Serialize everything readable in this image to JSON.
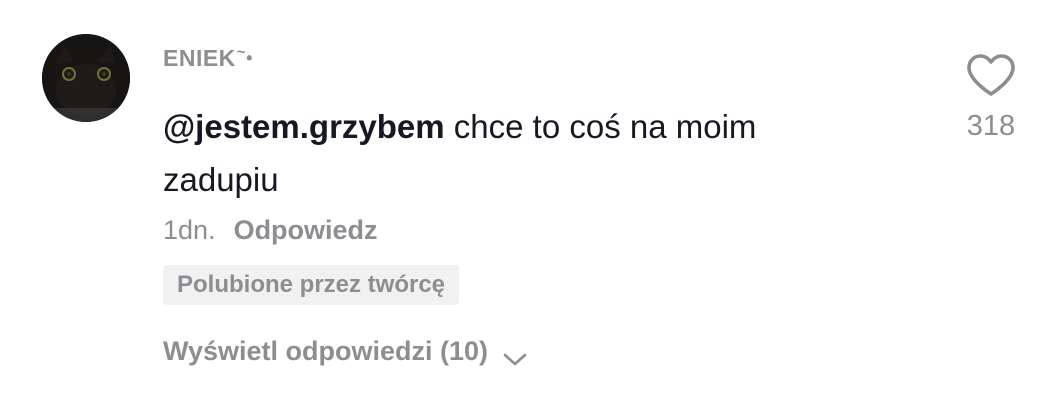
{
  "comment": {
    "username": "ENIEK",
    "username_decoration": "~",
    "username_dot": "•",
    "mention": "@jestem.grzybem",
    "text": " chce to coś na moim zadupiu",
    "time": "1dn.",
    "reply_label": "Odpowiedz",
    "creator_badge": "Polubione przez twórcę",
    "view_replies_label": "Wyświetl odpowiedzi (10)",
    "like_count": "318"
  },
  "icons": {
    "like": "heart-outline-icon",
    "expand": "chevron-down-icon",
    "avatar": "black-cat-avatar"
  },
  "colors": {
    "text": "#161823",
    "muted": "#8e8e92",
    "badge_bg": "#f1f1f2"
  }
}
